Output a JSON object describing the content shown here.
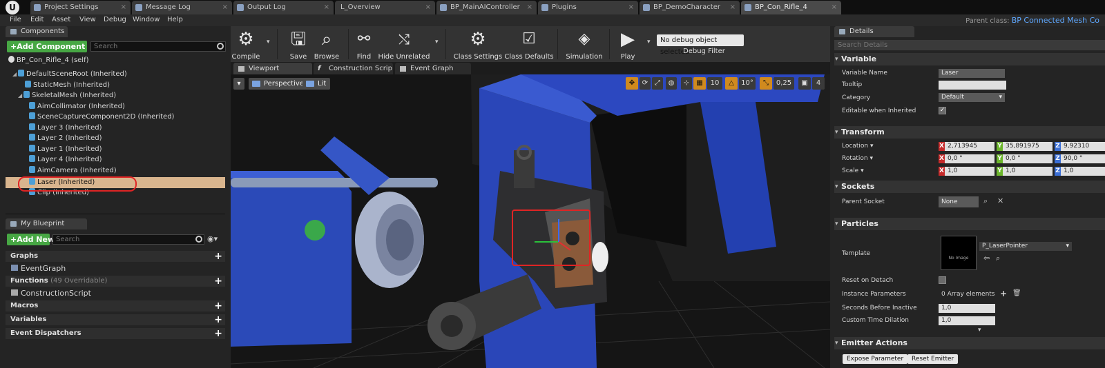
{
  "tabs": [
    {
      "label": "Project Settings",
      "active": false
    },
    {
      "label": "Message Log",
      "active": false
    },
    {
      "label": "Output Log",
      "active": false
    },
    {
      "label": "L_Overview",
      "active": false
    },
    {
      "label": "BP_MainAIController",
      "active": false
    },
    {
      "label": "Plugins",
      "active": false
    },
    {
      "label": "BP_DemoCharacter",
      "active": false
    },
    {
      "label": "BP_Con_Rifle_4",
      "active": true
    }
  ],
  "menu": [
    "File",
    "Edit",
    "Asset",
    "View",
    "Debug",
    "Window",
    "Help"
  ],
  "parent_class": {
    "label": "Parent class:",
    "value": "BP Connected Mesh Co"
  },
  "components": {
    "tab": "Components",
    "add_label": "+Add Component",
    "search_placeholder": "Search",
    "self_label": "BP_Con_Rifle_4 (self)",
    "tree": [
      "DefaultSceneRoot (Inherited)",
      "StaticMesh (Inherited)",
      "SkeletalMesh (Inherited)",
      "AimCollimator (Inherited)",
      "SceneCaptureComponent2D (Inherited)",
      "Layer 3 (Inherited)",
      "Layer 2 (Inherited)",
      "Layer 1 (Inherited)",
      "Layer 4 (Inherited)",
      "AimCamera (Inherited)",
      "Laser (Inherited)",
      "Clip (Inherited)"
    ]
  },
  "my_blueprint": {
    "tab": "My Blueprint",
    "add_label": "+Add New",
    "search_placeholder": "Search",
    "graphs": "Graphs",
    "event_graph": "EventGraph",
    "functions": "Functions",
    "functions_count": "(49 Overridable)",
    "construction_script": "ConstructionScript",
    "macros": "Macros",
    "variables": "Variables",
    "event_dispatchers": "Event Dispatchers"
  },
  "toolbar": {
    "compile": "Compile",
    "save": "Save",
    "browse": "Browse",
    "find": "Find",
    "hide_unrelated": "Hide Unrelated",
    "class_settings": "Class Settings",
    "class_defaults": "Class Defaults",
    "simulation": "Simulation",
    "play": "Play",
    "debug_select": "No debug object selected",
    "debug_filter": "Debug Filter"
  },
  "editor_tabs": [
    "Viewport",
    "Construction Scrip",
    "Event Graph"
  ],
  "viewport": {
    "perspective": "Perspective",
    "lit": "Lit",
    "grid_snap": "10",
    "rot_snap": "10°",
    "scale_snap": "0,25",
    "cam_speed": "4"
  },
  "details": {
    "tab": "Details",
    "search_placeholder": "Search Details",
    "variable": "Variable",
    "variable_name_label": "Variable Name",
    "variable_name": "Laser",
    "tooltip_label": "Tooltip",
    "category_label": "Category",
    "category_value": "Default",
    "editable_label": "Editable when Inherited",
    "transform": "Transform",
    "location_label": "Location",
    "location": [
      "2,713945",
      "35,891975",
      "9,92310"
    ],
    "rotation_label": "Rotation",
    "rotation": [
      "0,0 °",
      "0,0 °",
      "90,0 °"
    ],
    "scale_label": "Scale",
    "scale": [
      "1,0",
      "1,0",
      "1,0"
    ],
    "sockets": "Sockets",
    "parent_socket_label": "Parent Socket",
    "parent_socket": "None",
    "particles": "Particles",
    "template_label": "Template",
    "template_value": "P_LaserPointer",
    "no_image": "No Image",
    "reset_on_detach_label": "Reset on Detach",
    "instance_params_label": "Instance Parameters",
    "instance_params_value": "0 Array elements",
    "seconds_label": "Seconds Before Inactive",
    "seconds_value": "1,0",
    "dilation_label": "Custom Time Dilation",
    "dilation_value": "1,0",
    "emitter_actions": "Emitter Actions",
    "expose_param": "Expose Parameter",
    "reset_emitter": "Reset Emitter"
  },
  "colors": {
    "accent_green": "#47a744",
    "selection": "#d9b58e",
    "highlight_red": "#e02424",
    "link_blue": "#5fa8ff"
  }
}
